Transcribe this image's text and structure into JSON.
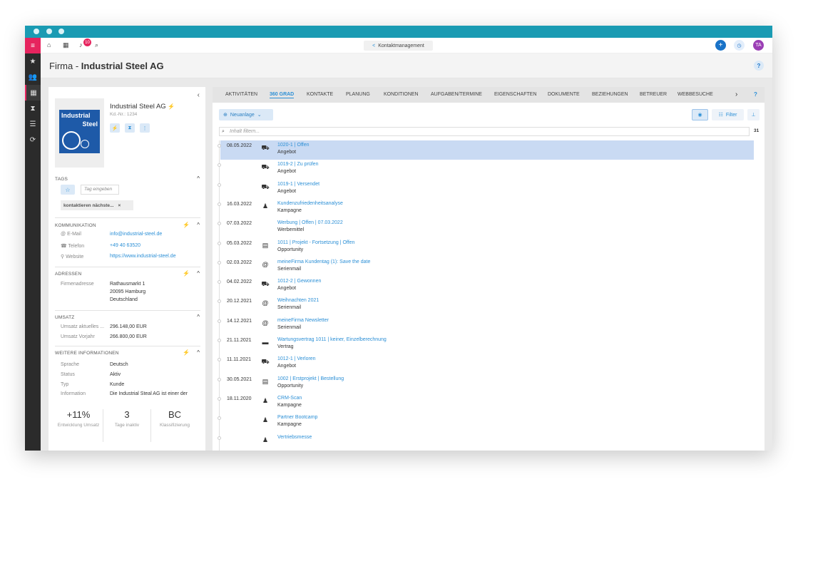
{
  "topbar": {
    "notification_count": "10",
    "module_label": "Kontaktmanagement",
    "user_initials": "TA"
  },
  "title": {
    "prefix": "Firma - ",
    "name": "Industrial Steel AG",
    "help": "?"
  },
  "company": {
    "name": "Industrial Steel AG",
    "customer_no": "Kd.-Nr.: 1234",
    "logo_line1": "Industrial",
    "logo_line2": "Steel"
  },
  "tags": {
    "header": "TAGS",
    "placeholder": "Tag eingeben",
    "chip": "kontaktieren nächste..."
  },
  "communication": {
    "header": "KOMMUNIKATION",
    "email_label": "E-Mail",
    "email": "info@industrial-steel.de",
    "phone_label": "Telefon",
    "phone": "+49 40 63520",
    "web_label": "Website",
    "web": "https://www.industrial-steel.de"
  },
  "addresses": {
    "header": "ADRESSEN",
    "label": "Firmenadresse",
    "line1": "Rathausmarkt 1",
    "line2": "20095 Hamburg",
    "line3": "Deutschland"
  },
  "revenue": {
    "header": "UMSATZ",
    "current_label": "Umsatz aktuelles ...",
    "current": "296.148,00 EUR",
    "prev_label": "Umsatz Vorjahr",
    "prev": "266.800,00 EUR"
  },
  "more": {
    "header": "WEITERE INFORMATIONEN",
    "rows": [
      {
        "label": "Sprache",
        "value": "Deutsch"
      },
      {
        "label": "Status",
        "value": "Aktiv"
      },
      {
        "label": "Typ",
        "value": "Kunde"
      },
      {
        "label": "Information",
        "value": "Die Industrial Steal AG ist einer der"
      }
    ]
  },
  "stats": [
    {
      "value": "+11%",
      "label": "Entwicklung Umsatz"
    },
    {
      "value": "3",
      "label": "Tage inaktiv"
    },
    {
      "value": "BC",
      "label": "Klassifizierung"
    }
  ],
  "tabs": [
    "AKTIVITÄTEN",
    "360 GRAD",
    "KONTAKTE",
    "PLANUNG",
    "KONDITIONEN",
    "AUFGABEN/TERMINE",
    "EIGENSCHAFTEN",
    "DOKUMENTE",
    "BEZIEHUNGEN",
    "BETREUER",
    "WEBBESUCHE"
  ],
  "toolbar": {
    "new_label": "Neuanlage",
    "filter_label": "Filter",
    "filter_placeholder": "Inhalt filtern...",
    "count": "31"
  },
  "timeline": [
    {
      "date": "08.05.2022",
      "icon": "cart-icon",
      "title": "1020-1 | Offen",
      "sub": "Angebot"
    },
    {
      "date": "",
      "icon": "cart-icon",
      "title": "1019-2 | Zu prüfen",
      "sub": "Angebot"
    },
    {
      "date": "",
      "icon": "cart-icon",
      "title": "1019-1 | Versendet",
      "sub": "Angebot"
    },
    {
      "date": "16.03.2022",
      "icon": "group-icon",
      "title": "Kundenzufriedenheitsanalyse",
      "sub": "Kampagne"
    },
    {
      "date": "07.03.2022",
      "icon": "",
      "title": "Werbung | Offen | 07.03.2022",
      "sub": "Werbemittel"
    },
    {
      "date": "05.03.2022",
      "icon": "document-icon",
      "title": "1011 | Projekt - Fortsetzung | Offen",
      "sub": "Opportunity"
    },
    {
      "date": "02.03.2022",
      "icon": "at-icon",
      "title": "meineFirma Kundentag (1): Save the date",
      "sub": "Serienmail"
    },
    {
      "date": "04.02.2022",
      "icon": "cart-icon",
      "title": "1012-2 | Gewonnen",
      "sub": "Angebot"
    },
    {
      "date": "20.12.2021",
      "icon": "at-icon",
      "title": "Weihnachten 2021",
      "sub": "Serienmail"
    },
    {
      "date": "14.12.2021",
      "icon": "at-icon",
      "title": "meineFirma Newsletter",
      "sub": "Serienmail"
    },
    {
      "date": "21.11.2021",
      "icon": "file-icon",
      "title": "Wartungsvertrag 1011 | keiner, Einzelberechnung",
      "sub": "Vertrag"
    },
    {
      "date": "11.11.2021",
      "icon": "cart-icon",
      "title": "1012-1 | Verloren",
      "sub": "Angebot"
    },
    {
      "date": "30.05.2021",
      "icon": "document-icon",
      "title": "1002 | Erstprojekt | Bestellung",
      "sub": "Opportunity"
    },
    {
      "date": "18.11.2020",
      "icon": "group-icon",
      "title": "CRM-Scan",
      "sub": "Kampagne"
    },
    {
      "date": "",
      "icon": "group-icon",
      "title": "Partner Bootcamp",
      "sub": "Kampagne"
    },
    {
      "date": "",
      "icon": "group-icon",
      "title": "Vertriebsmesse",
      "sub": ""
    }
  ]
}
